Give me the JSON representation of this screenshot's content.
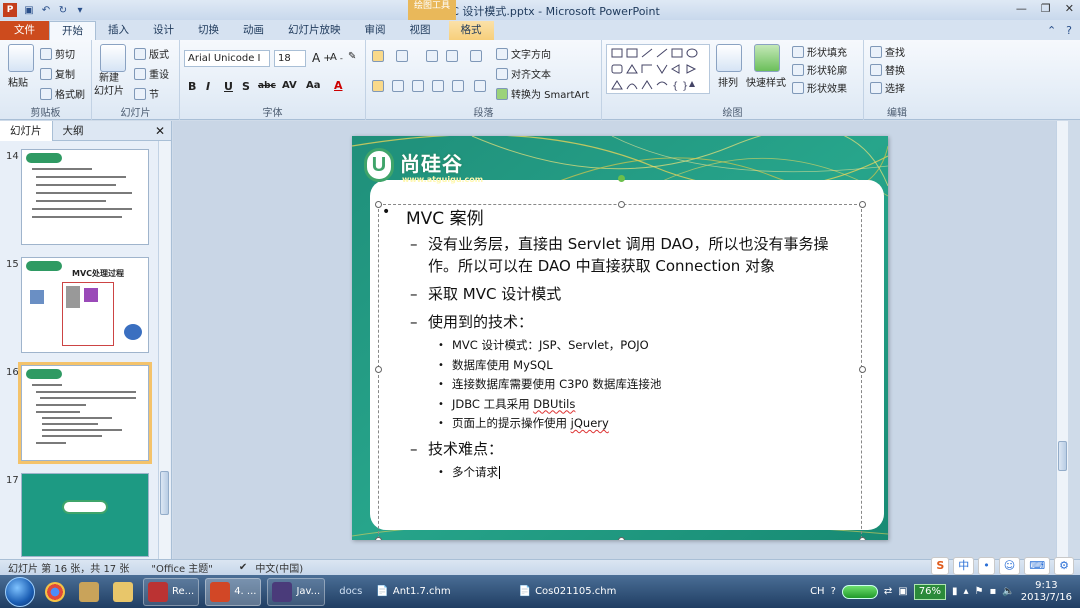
{
  "window": {
    "title": "4. MVC 设计模式.pptx - Microsoft PowerPoint",
    "tools_title": "绘图工具",
    "app_icon": "P"
  },
  "tabs": [
    "文件",
    "开始",
    "插入",
    "设计",
    "切换",
    "动画",
    "幻灯片放映",
    "审阅",
    "视图",
    "格式"
  ],
  "ribbon": {
    "clipboard": {
      "label": "剪贴板",
      "paste": "粘贴",
      "cut": "剪切",
      "copy": "复制",
      "format_painter": "格式刷"
    },
    "slides": {
      "label": "幻灯片",
      "new_slide": "新建\n幻灯片",
      "layout": "版式",
      "reset": "重设",
      "section": "节"
    },
    "font": {
      "label": "字体",
      "font_name": "Arial Unicode I",
      "font_size": "18",
      "bold": "B",
      "italic": "I",
      "underline": "U",
      "strike": "S",
      "shadow": "abc",
      "spacing": "AV",
      "case": "Aa",
      "color": "A"
    },
    "paragraph": {
      "label": "段落",
      "text_direction": "文字方向",
      "align_text": "对齐文本",
      "smartart": "转换为 SmartArt"
    },
    "drawing": {
      "label": "绘图",
      "arrange": "排列",
      "quick_styles": "快速样式",
      "shape_fill": "形状填充",
      "shape_outline": "形状轮廓",
      "shape_effects": "形状效果"
    },
    "editing": {
      "label": "编辑",
      "find": "查找",
      "replace": "替换",
      "select": "选择"
    }
  },
  "left_panel": {
    "tabs": [
      "幻灯片",
      "大纲"
    ],
    "thumbnails": [
      {
        "num": "14"
      },
      {
        "num": "15",
        "title": "MVC处理过程"
      },
      {
        "num": "16"
      },
      {
        "num": "17"
      }
    ]
  },
  "slide": {
    "logo_char": "U",
    "logo_text": "尚硅谷",
    "logo_url": "www.atguigu.com",
    "heading": "MVC 案例",
    "items": [
      {
        "level": 2,
        "text": "没有业务层，直接由 Servlet 调用 DAO，所以也没有事务操作。所以可以在 DAO 中直接获取 Connection 对象"
      },
      {
        "level": 2,
        "text": "采取 MVC 设计模式"
      },
      {
        "level": 2,
        "text": "使用到的技术："
      },
      {
        "level": 3,
        "text": "MVC 设计模式：JSP、Servlet，POJO"
      },
      {
        "level": 3,
        "text": "数据库使用 MySQL"
      },
      {
        "level": 3,
        "text": "连接数据库需要使用 C3P0 数据库连接池"
      },
      {
        "level": 3,
        "text": "JDBC 工具采用 ",
        "squiggle": "DBUtils"
      },
      {
        "level": 3,
        "text": "页面上的提示操作使用 ",
        "squiggle": "jQuery"
      },
      {
        "level": 2,
        "text": "技术难点："
      },
      {
        "level": 3,
        "text": "多个请求"
      }
    ]
  },
  "statusbar": {
    "slide_count": "幻灯片 第 16 张，共 17 张",
    "theme": "\"Office 主题\"",
    "language": "中文(中国)",
    "ime": "中"
  },
  "taskbar": {
    "items": [
      "Re...",
      "4. ...",
      "Jav..."
    ],
    "docs_label": "docs",
    "files": [
      "Ant1.7.chm",
      "Cos021105.chm"
    ],
    "lang": "CH",
    "battery_pct": "76%",
    "time": "9:13",
    "date": "2013/7/16"
  },
  "colors": {
    "file_tab": "#cd4b1d",
    "slide_teal": "#1d9a83",
    "format_tab": "#f7cf7b",
    "logo_green": "#3fa46a"
  }
}
